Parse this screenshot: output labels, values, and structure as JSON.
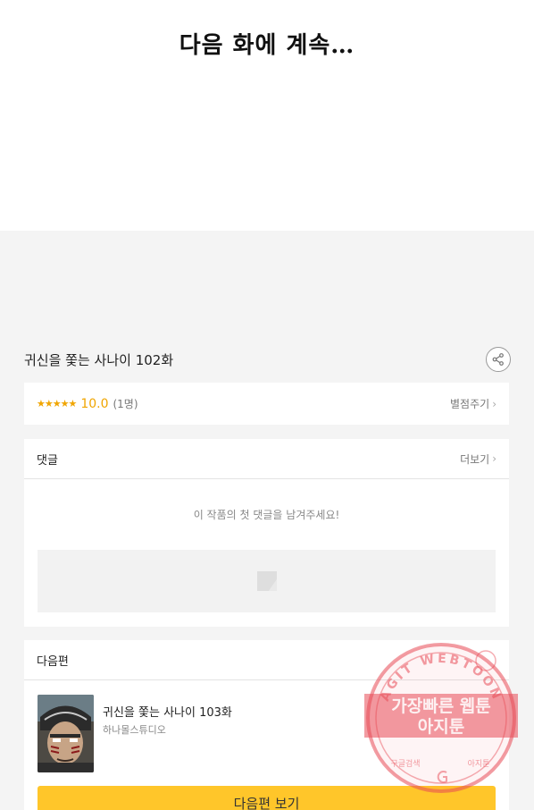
{
  "comic": {
    "end_text": "다음 화에 계속…"
  },
  "episode": {
    "title": "귀신을 쫓는 사나이 102화"
  },
  "rating": {
    "stars": "★★★★★",
    "score": "10.0",
    "count": "(1명)",
    "rate_label": "별점주기"
  },
  "comments": {
    "title": "댓글",
    "more_label": "더보기",
    "empty_message": "이 작품의 첫 댓글을 남겨주세요!"
  },
  "next": {
    "section_title": "다음편",
    "episode_title": "귀신을 쫓는 사나이 103화",
    "studio": "하나몰스튜디오",
    "button_label": "다음편 보기"
  },
  "watermark": {
    "arc_text": "AGIT WEBTOON",
    "line1": "가장빠른 웹툰",
    "line2": "아지툰",
    "bottom_left": "구글검색",
    "bottom_right": "아지툰",
    "color": "#e84a55"
  },
  "colors": {
    "accent_yellow": "#ffc62a",
    "star_orange": "#f0a500",
    "background": "#f4f4f4"
  }
}
